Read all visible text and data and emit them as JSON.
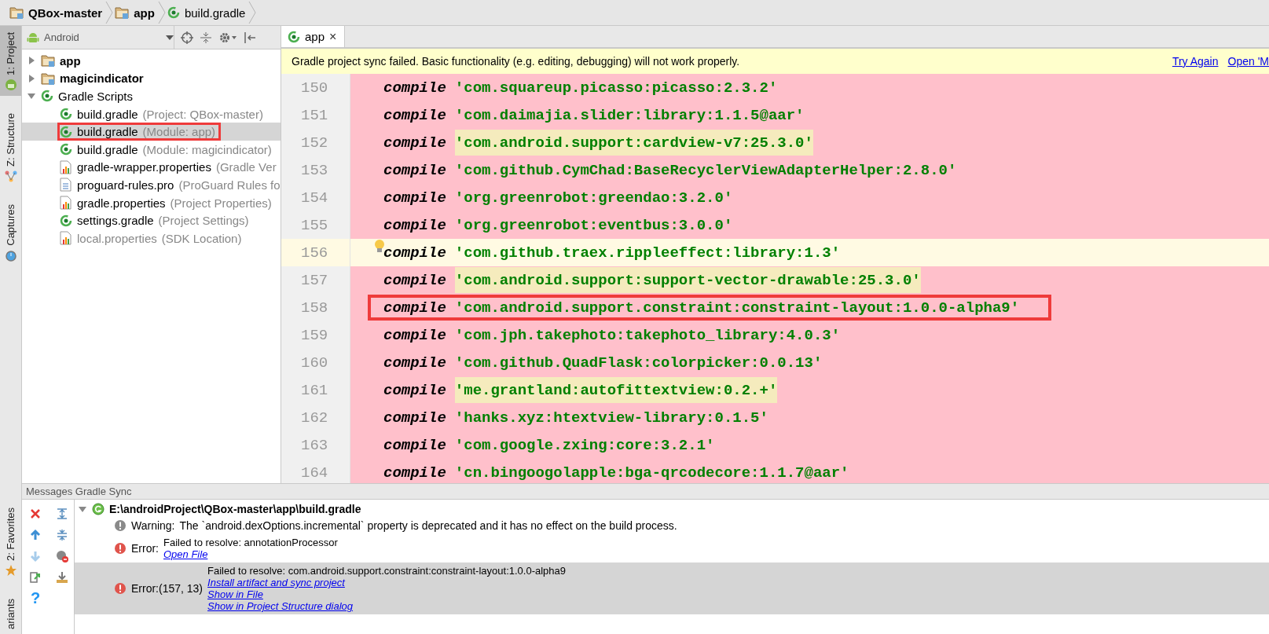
{
  "breadcrumbs": [
    {
      "label": "QBox-master",
      "kind": "folder"
    },
    {
      "label": "app",
      "kind": "folder"
    },
    {
      "label": "build.gradle",
      "kind": "gradle"
    }
  ],
  "tool_stripe": {
    "top": [
      {
        "label": "1: Project",
        "kind": "project",
        "selected": true
      },
      {
        "label": "Z: Structure",
        "kind": "structure",
        "selected": false
      },
      {
        "label": "Captures",
        "kind": "captures",
        "selected": false
      }
    ],
    "bottom": [
      {
        "label": "2: Favorites",
        "kind": "favorites",
        "selected": false
      },
      {
        "label": "ariants",
        "kind": "variants",
        "selected": false
      }
    ]
  },
  "project_panel": {
    "view": "Android",
    "tree": [
      {
        "name": "app",
        "kind": "module",
        "expanded": false,
        "selected": false
      },
      {
        "name": "magicindicator",
        "kind": "module",
        "expanded": false,
        "selected": false
      },
      {
        "name": "Gradle Scripts",
        "kind": "gradle-group",
        "expanded": true,
        "selected": false,
        "children": [
          {
            "name": "build.gradle",
            "hint": "(Project: QBox-master)",
            "kind": "gradle",
            "selected": false,
            "marked": false,
            "dimmed": false
          },
          {
            "name": "build.gradle",
            "hint": "(Module: app)",
            "kind": "gradle",
            "selected": true,
            "marked": true,
            "dimmed": false
          },
          {
            "name": "build.gradle",
            "hint": "(Module: magicindicator)",
            "kind": "gradle",
            "selected": false,
            "marked": false,
            "dimmed": false
          },
          {
            "name": "gradle-wrapper.properties",
            "hint": "(Gradle Ver",
            "kind": "properties",
            "selected": false,
            "marked": false,
            "dimmed": false
          },
          {
            "name": "proguard-rules.pro",
            "hint": "(ProGuard Rules fo",
            "kind": "text",
            "selected": false,
            "marked": false,
            "dimmed": false
          },
          {
            "name": "gradle.properties",
            "hint": "(Project Properties)",
            "kind": "properties",
            "selected": false,
            "marked": false,
            "dimmed": false
          },
          {
            "name": "settings.gradle",
            "hint": "(Project Settings)",
            "kind": "gradle",
            "selected": false,
            "marked": false,
            "dimmed": false
          },
          {
            "name": "local.properties",
            "hint": "(SDK Location)",
            "kind": "properties",
            "selected": false,
            "marked": false,
            "dimmed": true
          }
        ]
      }
    ]
  },
  "editor": {
    "tab": {
      "label": "app",
      "close": "×",
      "selected": true
    },
    "banner": {
      "message": "Gradle project sync failed. Basic functionality (e.g. editing, debugging) will not work properly.",
      "links": [
        "Try Again",
        "Open 'M"
      ]
    },
    "lines": [
      {
        "number": "150",
        "keyword": "compile",
        "value": "'com.squareup.picasso:picasso:2.3.2'",
        "kind": "error",
        "highlighted": false,
        "marked": false
      },
      {
        "number": "151",
        "keyword": "compile",
        "value": "'com.daimajia.slider:library:1.1.5@aar'",
        "kind": "error",
        "highlighted": false,
        "marked": false
      },
      {
        "number": "152",
        "keyword": "compile",
        "value": "'com.android.support:cardview-v7:25.3.0'",
        "kind": "error",
        "highlighted": true,
        "marked": false
      },
      {
        "number": "153",
        "keyword": "compile",
        "value": "'com.github.CymChad:BaseRecyclerViewAdapterHelper:2.8.0'",
        "kind": "error",
        "highlighted": false,
        "marked": false
      },
      {
        "number": "154",
        "keyword": "compile",
        "value": "'org.greenrobot:greendao:3.2.0'",
        "kind": "error",
        "highlighted": false,
        "marked": false
      },
      {
        "number": "155",
        "keyword": "compile",
        "value": "'org.greenrobot:eventbus:3.0.0'",
        "kind": "error",
        "highlighted": false,
        "marked": false
      },
      {
        "number": "156",
        "keyword": "compile",
        "value": "'com.github.traex.rippleeffect:library:1.3'",
        "kind": "current",
        "highlighted": false,
        "marked": false
      },
      {
        "number": "157",
        "keyword": "compile",
        "value": "'com.android.support:support-vector-drawable:25.3.0'",
        "kind": "error",
        "highlighted": true,
        "marked": false
      },
      {
        "number": "158",
        "keyword": "compile",
        "value": "'com.android.support.constraint:constraint-layout:1.0.0-alpha9'",
        "kind": "error",
        "highlighted": false,
        "marked": true
      },
      {
        "number": "159",
        "keyword": "compile",
        "value": "'com.jph.takephoto:takephoto_library:4.0.3'",
        "kind": "error",
        "highlighted": false,
        "marked": false
      },
      {
        "number": "160",
        "keyword": "compile",
        "value": "'com.github.QuadFlask:colorpicker:0.0.13'",
        "kind": "error",
        "highlighted": false,
        "marked": false
      },
      {
        "number": "161",
        "keyword": "compile",
        "value": "'me.grantland:autofittextview:0.2.+'",
        "kind": "error",
        "highlighted": true,
        "marked": false
      },
      {
        "number": "162",
        "keyword": "compile",
        "value": "'hanks.xyz:htextview-library:0.1.5'",
        "kind": "error",
        "highlighted": false,
        "marked": false
      },
      {
        "number": "163",
        "keyword": "compile",
        "value": "'com.google.zxing:core:3.2.1'",
        "kind": "error",
        "highlighted": false,
        "marked": false
      },
      {
        "number": "164",
        "keyword": "compile",
        "value": "'cn.bingoogolapple:bga-qrcodecore:1.1.7@aar'",
        "kind": "error",
        "highlighted": false,
        "marked": false
      }
    ]
  },
  "messages": {
    "title": "Messages Gradle Sync",
    "toolbar": [
      {
        "kind": "close",
        "disabled": false
      },
      {
        "kind": "expand",
        "disabled": false
      },
      {
        "kind": "up",
        "disabled": false
      },
      {
        "kind": "collapse",
        "disabled": false
      },
      {
        "kind": "down",
        "disabled": true
      },
      {
        "kind": "filter",
        "disabled": false
      },
      {
        "kind": "export",
        "disabled": false
      },
      {
        "kind": "import",
        "disabled": false
      },
      {
        "kind": "help",
        "glyph": "?",
        "disabled": false
      }
    ],
    "file": {
      "path": "E:\\androidProject\\QBox-master\\app\\build.gradle",
      "expanded": true
    },
    "entries": [
      {
        "kind": "warning",
        "label": "Warning:",
        "text": "The `android.dexOptions.incremental` property is deprecated and it has no effect on the build process.",
        "selected": false
      },
      {
        "kind": "error",
        "label": "Error:",
        "text": "Failed to resolve: annotationProcessor",
        "links": [
          "Open File"
        ],
        "selected": false
      },
      {
        "kind": "error",
        "label": "Error:(157, 13)",
        "text": "Failed to resolve: com.android.support.constraint:constraint-layout:1.0.0-alpha9",
        "links": [
          "Install artifact and sync project",
          "Show in File",
          "Show in Project Structure dialog"
        ],
        "selected": true
      }
    ]
  }
}
